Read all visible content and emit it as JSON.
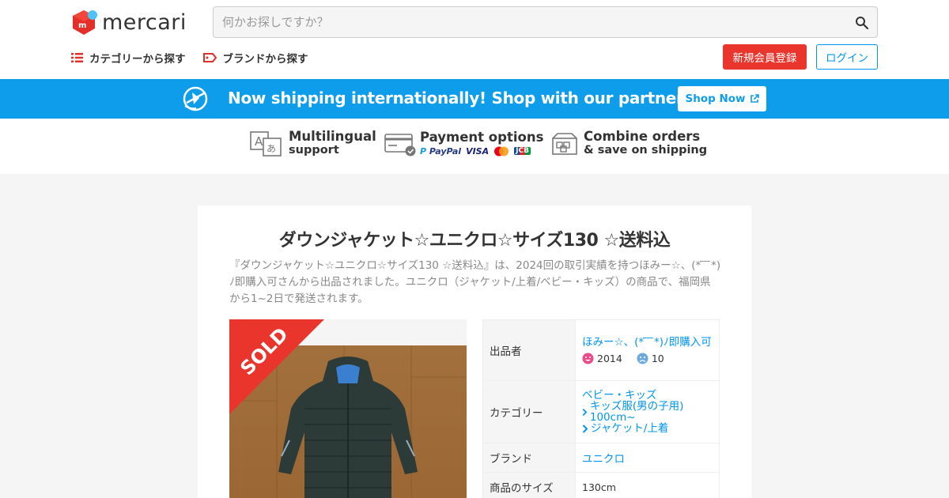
{
  "header": {
    "logo_text": "mercari",
    "search_placeholder": "何かお探しですか？",
    "nav": [
      {
        "label": "カテゴリーから探す"
      },
      {
        "label": "ブランドから探す"
      }
    ],
    "signup_label": "新規会員登録",
    "login_label": "ログイン"
  },
  "banner": {
    "text": "Now shipping internationally! Shop with our partner Buyee!",
    "button_label": "Shop Now"
  },
  "features": [
    {
      "line1": "Multilingual",
      "line2": "support"
    },
    {
      "line1": "Payment options",
      "pay_logos": [
        "PayPal",
        "VISA",
        "JCB"
      ]
    },
    {
      "line1": "Combine orders",
      "line2": "& save on shipping"
    }
  ],
  "item": {
    "title": "ダウンジャケット☆ユニクロ☆サイズ130 ☆送料込",
    "description": "『ダウンジャケット☆ユニクロ☆サイズ130 ☆送料込』は、2024回の取引実績を持つほみー☆、(* ̄ ̄ ̄*)ﾉ即購入可さんから出品されました。ユニクロ（ジャケット/上着/ベビー・キッズ）の商品で、福岡県から1~2日で発送されます。",
    "sold_label": "SOLD",
    "table": {
      "seller_label": "出品者",
      "seller_name": "ほみー☆、(* ̄ ̄ ̄*)ﾉ即購入可",
      "rating_good": "2014",
      "rating_bad": "10",
      "category_label": "カテゴリー",
      "category_top": "ベビー・キッズ",
      "category_mid": "キッズ服(男の子用) 100cm~",
      "category_leaf": "ジャケット/上着",
      "brand_label": "ブランド",
      "brand_value": "ユニクロ",
      "size_label": "商品のサイズ",
      "size_value": "130cm"
    }
  },
  "colors": {
    "brand_red": "#ea352d",
    "accent_blue": "#0095ee",
    "banner_blue": "#0d9deb"
  }
}
